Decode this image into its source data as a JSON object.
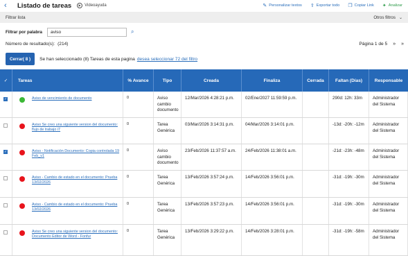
{
  "header": {
    "back_icon": "back-chevron-icon",
    "title": "Listado de tareas",
    "video_label": "Videoayuda",
    "actions": [
      {
        "label": "Personalizar textos",
        "icon": "edit-icon"
      },
      {
        "label": "Exportar todo",
        "icon": "export-icon"
      },
      {
        "label": "Copiar Link",
        "icon": "copy-icon"
      },
      {
        "label": "Analizar",
        "icon": "analyze-icon"
      }
    ]
  },
  "filter_bar": {
    "label": "Filtrar lista",
    "other_filters": "Otros filtros"
  },
  "word_filter": {
    "label": "Filtrar por palabra",
    "value": "aviso"
  },
  "results": {
    "label": "Número de resultado(s):",
    "count": "(214)"
  },
  "pager": {
    "text": "Página 1 de 5",
    "next": "»",
    "last": "»"
  },
  "selection": {
    "close_button": "Cerrar( 8 )",
    "text": "Se han seleccionado (8) Tareas de esta pagina",
    "link": "desea seleccionar 72 del filtro"
  },
  "table": {
    "columns": [
      "✓",
      "Tareas",
      "% Avance",
      "Tipo",
      "Creada",
      "Finaliza",
      "Cerrada",
      "Faltan (Días)",
      "Responsable"
    ],
    "rows": [
      {
        "checked": true,
        "status_color": "#3cb836",
        "tarea": "Aviso de vencimiento de documento",
        "avance": "0",
        "tipo": "Aviso cambio documento",
        "creada": "12/Mar/2026 4:28:21 p.m.",
        "finaliza": "02/Ene/2027 11:59:59 p.m.",
        "cerrada": "",
        "faltan": "290d: 12h: 33m",
        "responsable": "Administrador del Sistema"
      },
      {
        "checked": false,
        "status_color": "#e8141c",
        "tarea": "Aviso Se creo una siguiente version del documento: flujo de trabajo i7",
        "avance": "0",
        "tipo": "Tarea Genérica",
        "creada": "03/Mar/2026 3:14:31 p.m.",
        "finaliza": "04/Mar/2026 3:14:01 p.m.",
        "cerrada": "",
        "faltan": "-13d: -20h: -12m",
        "responsable": "Administrador del Sistema"
      },
      {
        "checked": true,
        "status_color": "#e8141c",
        "tarea": "Aviso - Notificación Documento: Copia controlada 19 Feb_v1",
        "avance": "0",
        "tipo": "Aviso cambio documento",
        "creada": "23/Feb/2026 11:37:57 a.m.",
        "finaliza": "24/Feb/2026 11:38:01 a.m.",
        "cerrada": "",
        "faltan": "-21d: -23h: -48m",
        "responsable": "Administrador del Sistema"
      },
      {
        "checked": false,
        "status_color": "#e8141c",
        "tarea": "Aviso - Cambio de estado en el documento: Prueba 13/02/2026",
        "avance": "0",
        "tipo": "Tarea Genérica",
        "creada": "13/Feb/2026 3:57:24 p.m.",
        "finaliza": "14/Feb/2026 3:56:01 p.m.",
        "cerrada": "",
        "faltan": "-31d: -19h: -30m",
        "responsable": "Administrador del Sistema"
      },
      {
        "checked": false,
        "status_color": "#e8141c",
        "tarea": "Aviso - Cambio de estado en el documento: Prueba 13/02/2026",
        "avance": "0",
        "tipo": "Tarea Genérica",
        "creada": "13/Feb/2026 3:57:23 p.m.",
        "finaliza": "14/Feb/2026 3:56:01 p.m.",
        "cerrada": "",
        "faltan": "-31d: -19h: -30m",
        "responsable": "Administrador del Sistema"
      },
      {
        "checked": false,
        "status_color": "#e8141c",
        "tarea": "Aviso Se creo una siguiente version del documento: Documento Editor de Word - Fonfur",
        "avance": "0",
        "tipo": "Tarea Genérica",
        "creada": "13/Feb/2026 3:29:22 p.m.",
        "finaliza": "14/Feb/2026 3:28:01 p.m.",
        "cerrada": "",
        "faltan": "-31d: -19h: -58m",
        "responsable": "Administrador del Sistema"
      }
    ]
  }
}
